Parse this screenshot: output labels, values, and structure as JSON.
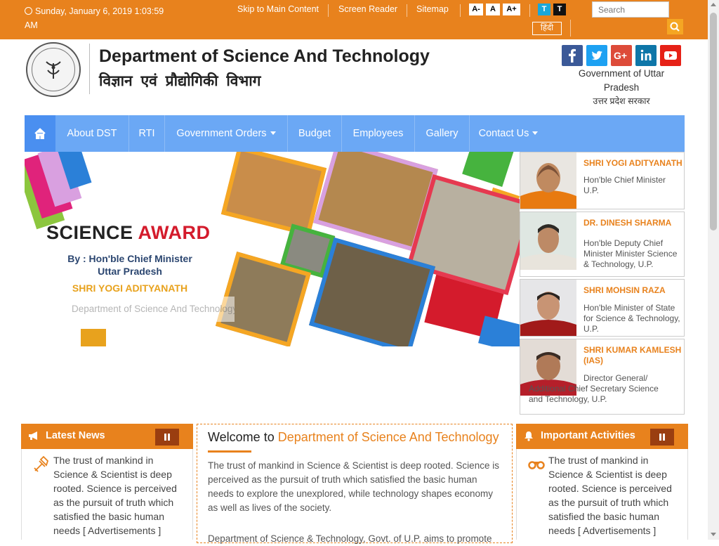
{
  "topbar": {
    "datetime": "Sunday, January 6, 2019 1:03:59 AM",
    "skip_link": "Skip to Main Content",
    "screen_reader": "Screen Reader",
    "sitemap": "Sitemap",
    "font_decrease": "A-",
    "font_normal": "A",
    "font_increase": "A+",
    "theme_light": "T",
    "theme_dark": "T",
    "hindi": "हिंदी",
    "search_placeholder": "Search"
  },
  "header": {
    "title": "Department of Science And Technology",
    "title_hindi": "विज्ञान एवं प्रौद्योगिकी विभाग",
    "gov_en": "Government of Uttar Pradesh",
    "gov_hi": "उत्तर प्रदेश सरकार",
    "social": [
      "facebook",
      "twitter",
      "google-plus",
      "linkedin",
      "youtube"
    ]
  },
  "nav": {
    "items": [
      {
        "label": "About DST"
      },
      {
        "label": "RTI"
      },
      {
        "label": "Government Orders"
      },
      {
        "label": "Budget"
      },
      {
        "label": "Employees"
      },
      {
        "label": "Gallery"
      },
      {
        "label": "Contact Us"
      }
    ]
  },
  "banner": {
    "title_a": "SCIENCE ",
    "title_b": "AWARD",
    "by_line1": "By : Hon'ble Chief Minister",
    "by_line2": "Uttar Pradesh",
    "name": "SHRI YOGI ADITYANATH",
    "caption": "Department of Science And Technology"
  },
  "officials": [
    {
      "name": "SHRI YOGI ADITYANATH",
      "role": "Hon'ble Chief Minister U.P."
    },
    {
      "name": "DR. DINESH SHARMA",
      "role": "Hon'ble Deputy Chief Minister Minister Science & Technology, U.P."
    },
    {
      "name": "SHRI MOHSIN RAZA",
      "role": "Hon'ble Minister of State for Science & Technology, U.P."
    },
    {
      "name": "SHRI KUMAR KAMLESH (IAS)",
      "role": "Director General/ Additional Chief Secretary Science and Technology, U.P."
    }
  ],
  "latest_news": {
    "title": "Latest News",
    "text": "The trust of mankind in Science & Scientist is deep rooted. Science is perceived as the pursuit of truth which satisfied the basic human needs [ Advertisements ]"
  },
  "welcome": {
    "title_prefix": "Welcome to ",
    "title_highlight": "Department of Science And Technology",
    "p1": "The trust of mankind in Science & Scientist is deep rooted. Science is perceived as the pursuit of truth which satisfied the basic human needs to explore the unexplored, while technology shapes economy as well as lives of the society.",
    "p2": "Department of Science & Technology, Govt. of U.P. aims to promote"
  },
  "activities": {
    "title": "Important Activities",
    "text": "The trust of mankind in Science & Scientist is deep rooted. Science is perceived as the pursuit of truth which satisfied the basic human needs [ Advertisements ]"
  },
  "colors": {
    "accent": "#e8821d",
    "nav": "#6ba8f5",
    "nav_active": "#4a8ff0"
  }
}
